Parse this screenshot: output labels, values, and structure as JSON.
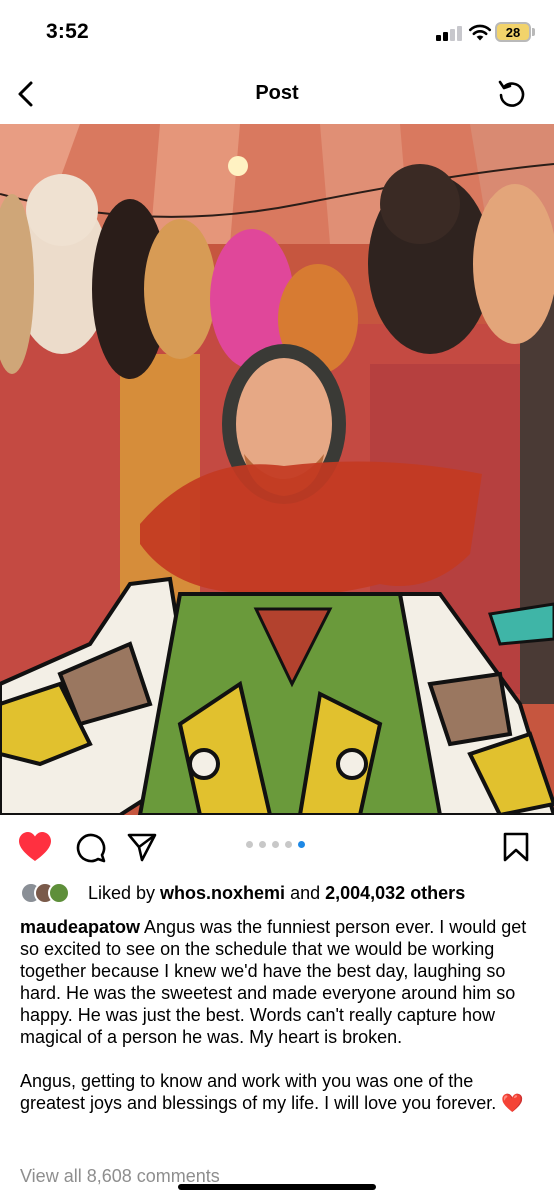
{
  "status_bar": {
    "time": "3:52",
    "battery": "28"
  },
  "header": {
    "title": "Post"
  },
  "post": {
    "carousel": {
      "count": 5,
      "active_index": 4
    },
    "liked_by_prefix": "Liked by ",
    "liked_by_user": "whos.noxhemi",
    "liked_by_and": " and ",
    "liked_by_others": "2,004,032 others",
    "caption_user": "maudeapatow",
    "caption_p1": " Angus was the funniest person ever. I would get so excited to see on the schedule that we would be working together because I knew we'd have the best day, laughing so hard. He was the sweetest and made everyone around him so happy. He was just the best. Words can't really capture how magical of a person he was. My heart is broken.",
    "caption_p2": "Angus, getting to know and work with you was one of the greatest joys and blessings of my life. I will love you forever.",
    "caption_emoji": "❤️",
    "view_comments": "View all 8,608 comments"
  },
  "icons": {
    "back": "chevron-left-icon",
    "refresh": "refresh-icon",
    "like": "heart-icon",
    "comment": "comment-icon",
    "share": "send-icon",
    "save": "bookmark-icon"
  },
  "colors": {
    "like_red": "#ff3040",
    "dot_active": "#1e88e5",
    "muted": "#8e8e8e"
  }
}
